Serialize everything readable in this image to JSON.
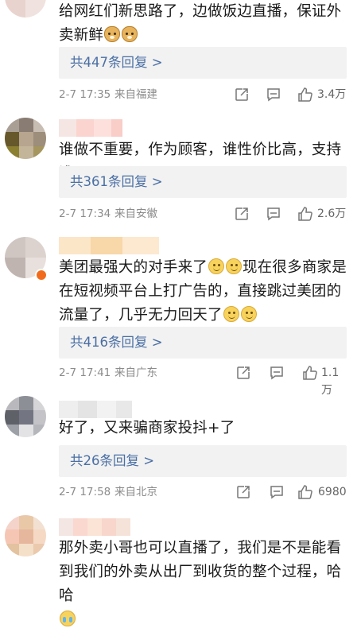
{
  "comments": [
    {
      "text_parts": [
        "给网红们新思路了，边做饭边直播，保证外卖新鲜"
      ],
      "emoji": [
        "doge-emoji",
        "doge-emoji"
      ],
      "replies_label": "共447条回复 >",
      "time": "2-7 17:35",
      "location": "来自福建",
      "likes": "3.4万"
    },
    {
      "text_parts": [
        "谁做不重要，作为顾客，谁性价比高，支持谁"
      ],
      "replies_label": "共361条回复 >",
      "time": "2-7 17:34",
      "location": "来自安徽",
      "likes": "2.6万"
    },
    {
      "text_parts": [
        "美团最强大的对手来了",
        "现在很多商家是在短视频平台上打广告的，直接跳过美团的流量了，几乎无力回天了"
      ],
      "emoji": [
        "smile-emoji"
      ],
      "replies_label": "共416条回复 >",
      "time": "2-7 17:41",
      "location": "来自广东",
      "likes": "1.1万"
    },
    {
      "text_parts": [
        "好了，又来骗商家投抖+了"
      ],
      "replies_label": "共26条回复 >",
      "time": "2-7 17:58",
      "location": "来自北京",
      "likes": "6980"
    },
    {
      "text_parts": [
        "那外卖小哥也可以直播了，我们是不是能看到我们的外卖从出厂到收货的整个过程，哈哈"
      ],
      "emoji": [
        "cry-laugh-emoji"
      ]
    }
  ],
  "icons": [
    "share-icon",
    "comment-icon",
    "like-icon"
  ],
  "colors": {
    "reply_link": "#4a6fa5",
    "reply_bg": "#f2f2f2",
    "meta_text": "#8c8c8c"
  }
}
